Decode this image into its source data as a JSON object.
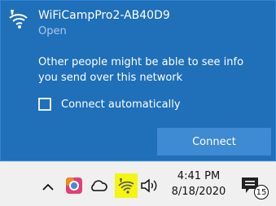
{
  "network": {
    "name": "WiFiCampPro2-AB40D9",
    "status": "Open",
    "warning": "Other people might be able to see info you send over this network",
    "connect_auto_label": "Connect automatically",
    "connect_auto_checked": false,
    "connect_button_label": "Connect"
  },
  "taskbar": {
    "time": "4:41 PM",
    "date": "8/18/2020",
    "notification_count": "15",
    "icons": [
      "chevron-up-icon",
      "app-icon",
      "cloud-icon",
      "wifi-icon",
      "volume-icon",
      "notification-icon"
    ]
  },
  "colors": {
    "flyout_bg": "#1f6fb9",
    "button_bg": "#3e8ad3",
    "status_text": "#a9c9ea",
    "highlight": "#f5f513",
    "taskbar_bg": "#f0f0f0"
  }
}
